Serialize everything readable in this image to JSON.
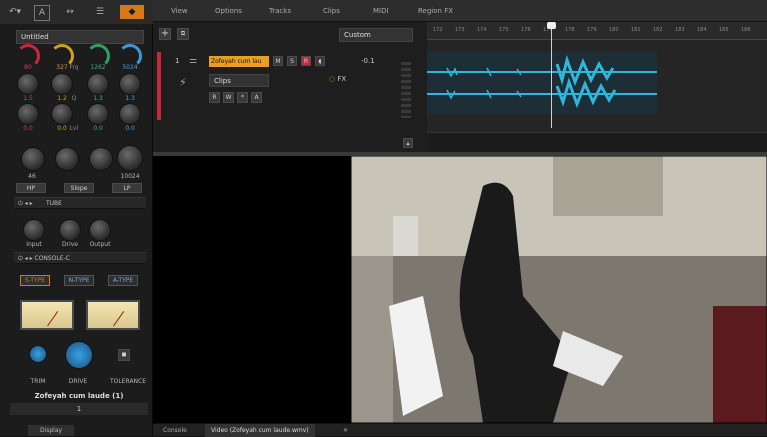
{
  "toolbar": {
    "icons": [
      "undo-icon",
      "a-icon",
      "midi-icon",
      "menu-icon",
      "host-icon"
    ]
  },
  "left": {
    "preset": "Untitled",
    "eq_values_row1": [
      "80",
      "327",
      "1262",
      "5024"
    ],
    "eq_values_row1_sep": "Frq",
    "eq_values_row2": [
      "1.5",
      "1.2",
      "1.3",
      "1.3"
    ],
    "eq_values_row2_sep": "Q",
    "eq_values_row3": [
      "0.0",
      "0.0",
      "0.0",
      "0.0"
    ],
    "eq_values_row3_sep": "Lvl",
    "filter_values": [
      "46",
      "",
      "10024"
    ],
    "filter_buttons": [
      "HP",
      "Slope",
      "LP"
    ],
    "module1": "TUBE",
    "tube_labels": [
      "Input",
      "Drive",
      "Output"
    ],
    "module2": "CONSOLE-C",
    "types": [
      "S-TYPE",
      "N-TYPE",
      "A-TYPE"
    ],
    "console_labels": [
      "TRIM",
      "DRIVE",
      "TOLERANCE"
    ],
    "track_name": "Zofeyah cum laude (1)",
    "track_num": "1",
    "display_tab": "Display"
  },
  "menu": [
    "View",
    "Options",
    "Tracks",
    "Clips",
    "MIDI",
    "Region FX"
  ],
  "track": {
    "number": "1",
    "name": "Zofeyah cum lau",
    "buttons": [
      "M",
      "S",
      "R"
    ],
    "volume": "-0.1",
    "clips_label": "Clips",
    "fx_label": "FX",
    "preset_label": "Custom",
    "wbtns": [
      "R",
      "W",
      "*",
      "A"
    ]
  },
  "ruler": [
    "172",
    "173",
    "174",
    "175",
    "176",
    "177",
    "178",
    "179",
    "180",
    "181",
    "182",
    "183",
    "184",
    "185",
    "186"
  ],
  "bottom_tabs": [
    "Console",
    "Video (Zofeyah cum laude.wmv)"
  ]
}
